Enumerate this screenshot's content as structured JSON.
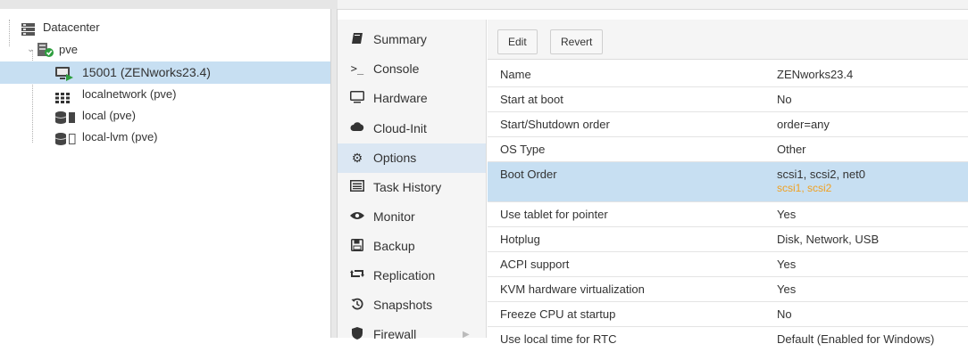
{
  "tree": {
    "datacenter": "Datacenter",
    "node": "pve",
    "items": [
      {
        "label": "15001 (ZENworks23.4)"
      },
      {
        "label": "localnetwork (pve)"
      },
      {
        "label": "local (pve)"
      },
      {
        "label": "local-lvm (pve)"
      }
    ]
  },
  "nav": {
    "items": [
      {
        "label": "Summary",
        "icon": "book-icon"
      },
      {
        "label": "Console",
        "icon": "terminal-icon"
      },
      {
        "label": "Hardware",
        "icon": "monitor-icon"
      },
      {
        "label": "Cloud-Init",
        "icon": "cloud-icon"
      },
      {
        "label": "Options",
        "icon": "gear-icon"
      },
      {
        "label": "Task History",
        "icon": "list-icon"
      },
      {
        "label": "Monitor",
        "icon": "eye-icon"
      },
      {
        "label": "Backup",
        "icon": "floppy-icon"
      },
      {
        "label": "Replication",
        "icon": "retweet-icon"
      },
      {
        "label": "Snapshots",
        "icon": "history-icon"
      },
      {
        "label": "Firewall",
        "icon": "shield-icon"
      }
    ]
  },
  "toolbar": {
    "edit_label": "Edit",
    "revert_label": "Revert"
  },
  "options": {
    "rows": [
      {
        "name": "Name",
        "value": "ZENworks23.4"
      },
      {
        "name": "Start at boot",
        "value": "No"
      },
      {
        "name": "Start/Shutdown order",
        "value": "order=any"
      },
      {
        "name": "OS Type",
        "value": "Other"
      },
      {
        "name": "Boot Order",
        "value": "scsi1, scsi2, net0",
        "pending": "scsi1, scsi2"
      },
      {
        "name": "Use tablet for pointer",
        "value": "Yes"
      },
      {
        "name": "Hotplug",
        "value": "Disk, Network, USB"
      },
      {
        "name": "ACPI support",
        "value": "Yes"
      },
      {
        "name": "KVM hardware virtualization",
        "value": "Yes"
      },
      {
        "name": "Freeze CPU at startup",
        "value": "No"
      },
      {
        "name": "Use local time for RTC",
        "value": "Default (Enabled for Windows)"
      }
    ]
  },
  "colors": {
    "selection": "#c7dff2",
    "pending": "#f0a020",
    "running": "#2e9e3e"
  }
}
